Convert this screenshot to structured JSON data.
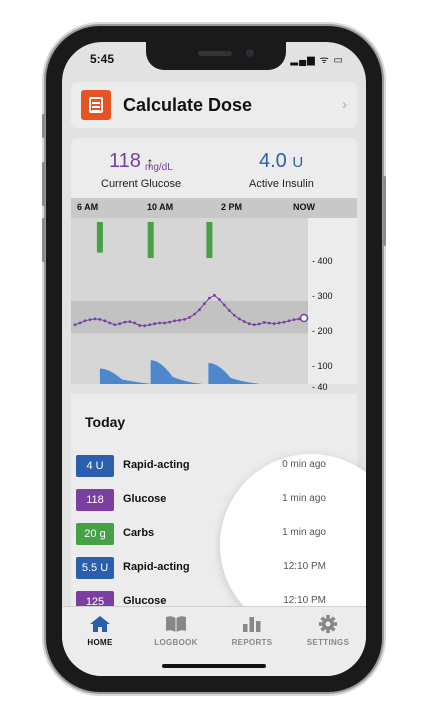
{
  "status": {
    "time": "5:45",
    "icons": "▂▄▆ ᯤ ▭"
  },
  "calculate": {
    "title": "Calculate Dose",
    "chevron": "›"
  },
  "glucose": {
    "value": "118",
    "unit": "mg/dL",
    "arrow": "↑",
    "label": "Current Glucose"
  },
  "insulin": {
    "value": "4.0",
    "unit": "U",
    "label": "Active Insulin"
  },
  "chart_data": {
    "type": "line",
    "time_ticks": [
      "6 AM",
      "10 AM",
      "2 PM",
      "NOW"
    ],
    "y_ticks": [
      "- 400",
      "- 300",
      "- 200",
      "- 100",
      "- 40"
    ],
    "glucose_series": {
      "x_hours": [
        0,
        0.5,
        1,
        1.5,
        2,
        2.5,
        3,
        3.5,
        4,
        4.5,
        5,
        5.5,
        6,
        6.5,
        7,
        7.5,
        8,
        8.5,
        9,
        9.5,
        10,
        10.5,
        11,
        11.5,
        12,
        12.5,
        13,
        13.5,
        14,
        14.5,
        15,
        15.5,
        16,
        16.5,
        17,
        17.5,
        18,
        18.5,
        19,
        19.5,
        20,
        20.5,
        21,
        21.5,
        22,
        22.5,
        23
      ],
      "values": [
        95,
        100,
        108,
        112,
        115,
        113,
        108,
        100,
        95,
        98,
        103,
        105,
        100,
        93,
        92,
        95,
        98,
        100,
        100,
        103,
        108,
        110,
        113,
        120,
        132,
        148,
        170,
        190,
        200,
        185,
        165,
        145,
        128,
        115,
        105,
        98,
        95,
        97,
        102,
        100,
        98,
        100,
        103,
        108,
        112,
        115,
        118
      ]
    },
    "carb_events": [
      {
        "hour": 2.5,
        "level": 0.7
      },
      {
        "hour": 7.6,
        "level": 1.0
      },
      {
        "hour": 13.5,
        "level": 1.0
      }
    ],
    "insulin_events": [
      {
        "hour": 2.5,
        "peak": 0.55
      },
      {
        "hour": 7.6,
        "peak": 0.85
      },
      {
        "hour": 13.4,
        "peak": 0.75
      }
    ],
    "target_range": [
      70,
      180
    ],
    "colors": {
      "glucose": "#7b3fa1",
      "carbs": "#45a046",
      "insulin": "#4f87cc"
    }
  },
  "today": {
    "title": "Today",
    "items": [
      {
        "badge": "4 U",
        "color": "#2b5fae",
        "label": "Rapid-acting",
        "time": "0 min ago"
      },
      {
        "badge": "118",
        "color": "#7b3fa1",
        "label": "Glucose",
        "time": "1 min ago"
      },
      {
        "badge": "20 g",
        "color": "#45a046",
        "label": "Carbs",
        "time": "1 min ago"
      },
      {
        "badge": "5.5 U",
        "color": "#2b5fae",
        "label": "Rapid-acting",
        "time": "12:10 PM"
      },
      {
        "badge": "125",
        "color": "#7b3fa1",
        "label": "Glucose",
        "time": "12:10 PM"
      }
    ]
  },
  "tabs": [
    {
      "label": "HOME",
      "icon": "home-icon",
      "active": true
    },
    {
      "label": "LOGBOOK",
      "icon": "book-icon",
      "active": false
    },
    {
      "label": "REPORTS",
      "icon": "bar-chart-icon",
      "active": false
    },
    {
      "label": "SETTINGS",
      "icon": "gear-icon",
      "active": false
    }
  ]
}
